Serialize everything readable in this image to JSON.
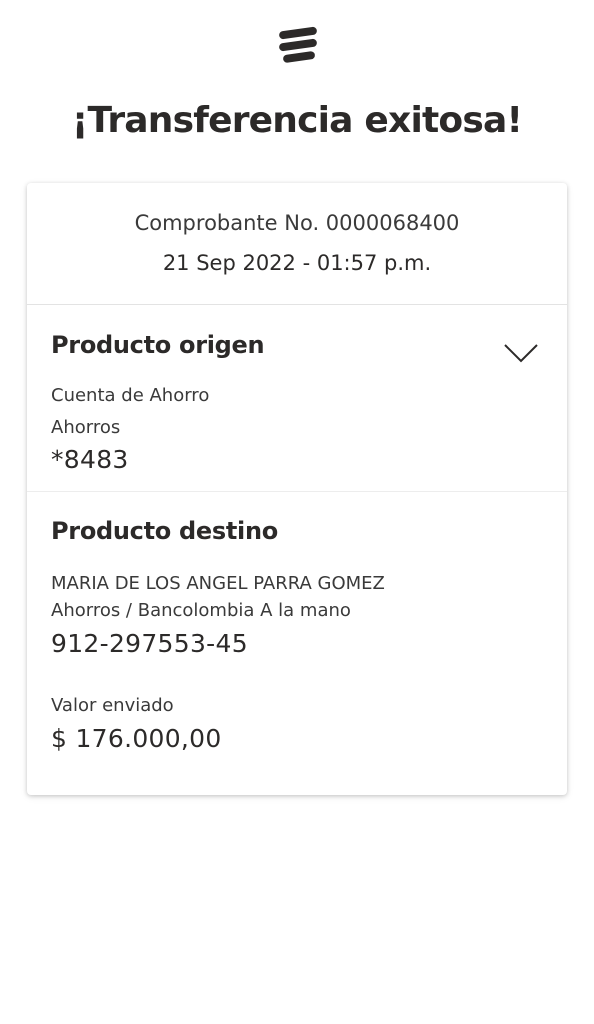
{
  "logo": {
    "icon": "bancolombia-logo-icon"
  },
  "title": "¡Transferencia exitosa!",
  "receipt": {
    "number_text": "Comprobante No. 0000068400",
    "datetime": "21 Sep 2022 - 01:57 p.m."
  },
  "origin": {
    "title": "Producto origen",
    "account_name": "Cuenta de Ahorro",
    "account_type": "Ahorros",
    "account_number": "*8483",
    "toggle_icon": "chevron-down-icon"
  },
  "destination": {
    "title": "Producto destino",
    "holder_name": "MARIA DE LOS ANGEL PARRA GOMEZ",
    "account_type_bank": "Ahorros / Bancolombia A la mano",
    "account_number": "912-297553-45",
    "amount_label": "Valor enviado",
    "amount": "$ 176.000,00"
  }
}
